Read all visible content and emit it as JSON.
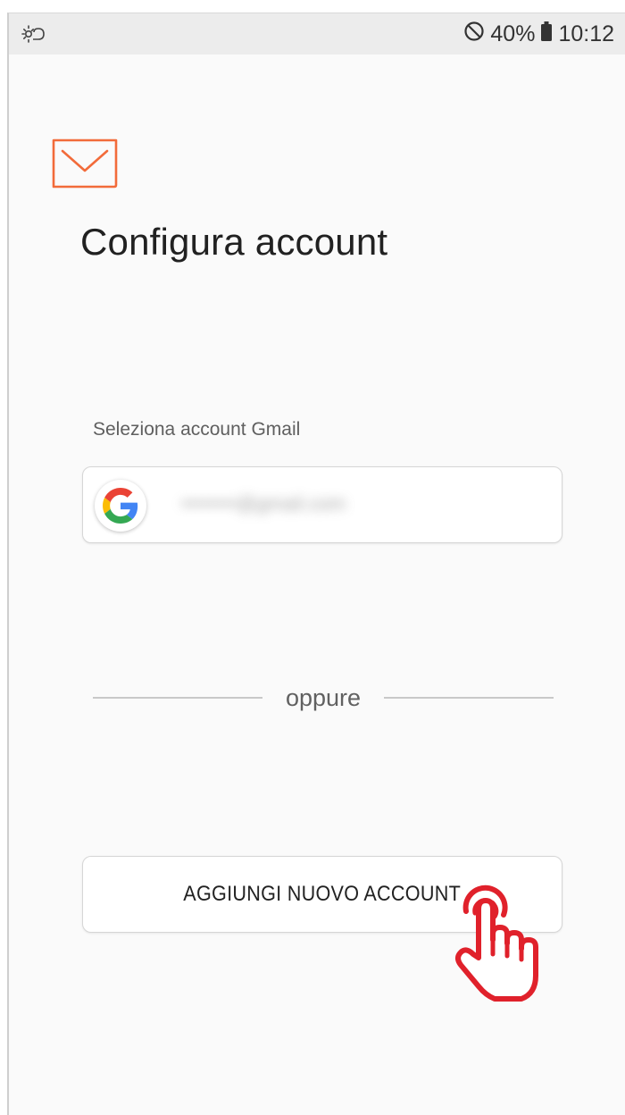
{
  "status_bar": {
    "left_icon": "brightness-sync-icon",
    "dnd_icon": "do-not-disturb-icon",
    "battery_percent": "40%",
    "battery_icon": "battery-icon",
    "time": "10:12"
  },
  "app": {
    "logo_icon": "mail-envelope-icon",
    "accent_color": "#f26b3a"
  },
  "page": {
    "title": "Configura account"
  },
  "gmail_section": {
    "label": "Seleziona account Gmail",
    "account_icon": "google-g-icon",
    "account_email": "••••••••@gmail.com"
  },
  "divider": {
    "text": "oppure"
  },
  "add_account": {
    "label": "AGGIUNGI NUOVO ACCOUNT"
  },
  "overlay": {
    "pointer_icon": "hand-pointer-icon",
    "pointer_color": "#e0212b"
  }
}
